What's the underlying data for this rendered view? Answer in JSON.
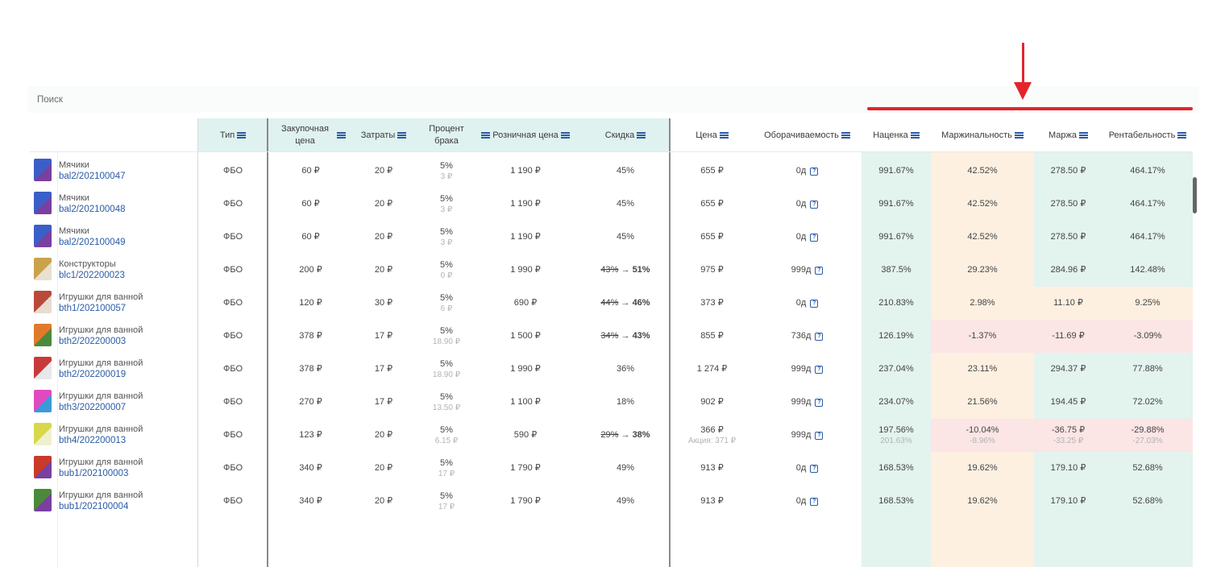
{
  "search": {
    "placeholder": "Поиск"
  },
  "colors": {
    "accent": "#2a5ba6",
    "annotation": "#e3242b",
    "header_bg": "#dff2f0",
    "green": "#e3f3ee",
    "orange": "#fdf0e1",
    "red": "#fbe5e5"
  },
  "columns": {
    "type": "Тип",
    "purchase": "Закупочная цена",
    "costs": "Затраты",
    "defect": "Процент брака",
    "retail": "Розничная цена",
    "discount": "Скидка",
    "price": "Цена",
    "turnover": "Оборачиваемость",
    "markup": "Наценка",
    "marginality": "Маржинальность",
    "margin": "Маржа",
    "profitability": "Рентабельность"
  },
  "rows": [
    {
      "category": "Мячики",
      "sku": "bal2/202100047",
      "type": "ФБО",
      "purchase": "60 ₽",
      "costs": "20 ₽",
      "defect": "5%",
      "defect_sub": "3 ₽",
      "retail": "1 190 ₽",
      "discount_old": "",
      "discount": "45%",
      "price": "655 ₽",
      "price_sub": "",
      "turnover": "0д",
      "markup": "991.67%",
      "markup_sub": "",
      "marginality": "42.52%",
      "marginality_sub": "",
      "margin": "278.50 ₽",
      "margin_sub": "",
      "profitability": "464.17%",
      "profitability_sub": ""
    },
    {
      "category": "Мячики",
      "sku": "bal2/202100048",
      "type": "ФБО",
      "purchase": "60 ₽",
      "costs": "20 ₽",
      "defect": "5%",
      "defect_sub": "3 ₽",
      "retail": "1 190 ₽",
      "discount_old": "",
      "discount": "45%",
      "price": "655 ₽",
      "price_sub": "",
      "turnover": "0д",
      "markup": "991.67%",
      "markup_sub": "",
      "marginality": "42.52%",
      "marginality_sub": "",
      "margin": "278.50 ₽",
      "margin_sub": "",
      "profitability": "464.17%",
      "profitability_sub": ""
    },
    {
      "category": "Мячики",
      "sku": "bal2/202100049",
      "type": "ФБО",
      "purchase": "60 ₽",
      "costs": "20 ₽",
      "defect": "5%",
      "defect_sub": "3 ₽",
      "retail": "1 190 ₽",
      "discount_old": "",
      "discount": "45%",
      "price": "655 ₽",
      "price_sub": "",
      "turnover": "0д",
      "markup": "991.67%",
      "markup_sub": "",
      "marginality": "42.52%",
      "marginality_sub": "",
      "margin": "278.50 ₽",
      "margin_sub": "",
      "profitability": "464.17%",
      "profitability_sub": ""
    },
    {
      "category": "Конструкторы",
      "sku": "blc1/202200023",
      "type": "ФБО",
      "purchase": "200 ₽",
      "costs": "20 ₽",
      "defect": "5%",
      "defect_sub": "0 ₽",
      "retail": "1 990 ₽",
      "discount_old": "43%",
      "discount": "51%",
      "price": "975 ₽",
      "price_sub": "",
      "turnover": "999д",
      "markup": "387.5%",
      "markup_sub": "",
      "marginality": "29.23%",
      "marginality_sub": "",
      "margin": "284.96 ₽",
      "margin_sub": "",
      "profitability": "142.48%",
      "profitability_sub": ""
    },
    {
      "category": "Игрушки для ванной",
      "sku": "bth1/202100057",
      "type": "ФБО",
      "purchase": "120 ₽",
      "costs": "30 ₽",
      "defect": "5%",
      "defect_sub": "6 ₽",
      "retail": "690 ₽",
      "discount_old": "44%",
      "discount": "46%",
      "price": "373 ₽",
      "price_sub": "",
      "turnover": "0д",
      "markup": "210.83%",
      "markup_sub": "",
      "marginality": "2.98%",
      "marginality_sub": "",
      "margin": "11.10 ₽",
      "margin_sub": "",
      "profitability": "9.25%",
      "profitability_sub": ""
    },
    {
      "category": "Игрушки для ванной",
      "sku": "bth2/202200003",
      "type": "ФБО",
      "purchase": "378 ₽",
      "costs": "17 ₽",
      "defect": "5%",
      "defect_sub": "18.90 ₽",
      "retail": "1 500 ₽",
      "discount_old": "34%",
      "discount": "43%",
      "price": "855 ₽",
      "price_sub": "",
      "turnover": "736д",
      "markup": "126.19%",
      "markup_sub": "",
      "marginality": "-1.37%",
      "marginality_sub": "",
      "margin": "-11.69 ₽",
      "margin_sub": "",
      "profitability": "-3.09%",
      "profitability_sub": ""
    },
    {
      "category": "Игрушки для ванной",
      "sku": "bth2/202200019",
      "type": "ФБО",
      "purchase": "378 ₽",
      "costs": "17 ₽",
      "defect": "5%",
      "defect_sub": "18.90 ₽",
      "retail": "1 990 ₽",
      "discount_old": "",
      "discount": "36%",
      "price": "1 274 ₽",
      "price_sub": "",
      "turnover": "999д",
      "markup": "237.04%",
      "markup_sub": "",
      "marginality": "23.11%",
      "marginality_sub": "",
      "margin": "294.37 ₽",
      "margin_sub": "",
      "profitability": "77.88%",
      "profitability_sub": ""
    },
    {
      "category": "Игрушки для ванной",
      "sku": "bth3/202200007",
      "type": "ФБО",
      "purchase": "270 ₽",
      "costs": "17 ₽",
      "defect": "5%",
      "defect_sub": "13.50 ₽",
      "retail": "1 100 ₽",
      "discount_old": "",
      "discount": "18%",
      "price": "902 ₽",
      "price_sub": "",
      "turnover": "999д",
      "markup": "234.07%",
      "markup_sub": "",
      "marginality": "21.56%",
      "marginality_sub": "",
      "margin": "194.45 ₽",
      "margin_sub": "",
      "profitability": "72.02%",
      "profitability_sub": ""
    },
    {
      "category": "Игрушки для ванной",
      "sku": "bth4/202200013",
      "type": "ФБО",
      "purchase": "123 ₽",
      "costs": "20 ₽",
      "defect": "5%",
      "defect_sub": "6.15 ₽",
      "retail": "590 ₽",
      "discount_old": "29%",
      "discount": "38%",
      "price": "366 ₽",
      "price_sub": "Акция: 371 ₽",
      "turnover": "999д",
      "markup": "197.56%",
      "markup_sub": "201.63%",
      "marginality": "-10.04%",
      "marginality_sub": "-8.96%",
      "margin": "-36.75 ₽",
      "margin_sub": "-33.25 ₽",
      "profitability": "-29.88%",
      "profitability_sub": "-27.03%"
    },
    {
      "category": "Игрушки для ванной",
      "sku": "bub1/202100003",
      "type": "ФБО",
      "purchase": "340 ₽",
      "costs": "20 ₽",
      "defect": "5%",
      "defect_sub": "17 ₽",
      "retail": "1 790 ₽",
      "discount_old": "",
      "discount": "49%",
      "price": "913 ₽",
      "price_sub": "",
      "turnover": "0д",
      "markup": "168.53%",
      "markup_sub": "",
      "marginality": "19.62%",
      "marginality_sub": "",
      "margin": "179.10 ₽",
      "margin_sub": "",
      "profitability": "52.68%",
      "profitability_sub": ""
    },
    {
      "category": "Игрушки для ванной",
      "sku": "bub1/202100004",
      "type": "ФБО",
      "purchase": "340 ₽",
      "costs": "20 ₽",
      "defect": "5%",
      "defect_sub": "17 ₽",
      "retail": "1 790 ₽",
      "discount_old": "",
      "discount": "49%",
      "price": "913 ₽",
      "price_sub": "",
      "turnover": "0д",
      "markup": "168.53%",
      "markup_sub": "",
      "marginality": "19.62%",
      "marginality_sub": "",
      "margin": "179.10 ₽",
      "margin_sub": "",
      "profitability": "52.68%",
      "profitability_sub": ""
    }
  ]
}
